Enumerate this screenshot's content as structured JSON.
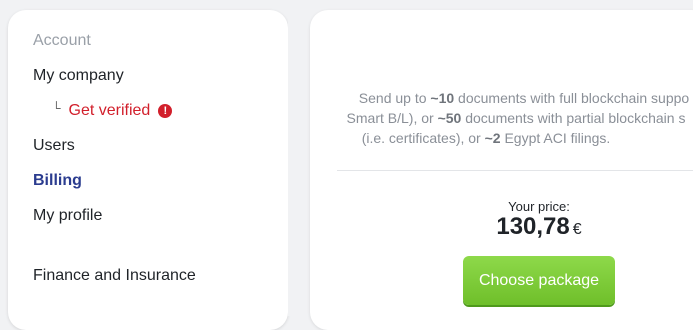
{
  "sidebar": {
    "section_title": "Account",
    "items": [
      {
        "label": "My company"
      },
      {
        "label": "Get verified"
      },
      {
        "label": "Users"
      },
      {
        "label": "Billing"
      },
      {
        "label": "My profile"
      },
      {
        "label": "Finance and Insurance"
      }
    ],
    "warning_icon_text": "!"
  },
  "package": {
    "description_line1_a": "Send up to ",
    "description_line1_b": "~10",
    "description_line1_c": " documents with full blockchain suppo",
    "description_line2_a": "Smart B/L), or ",
    "description_line2_b": "~50",
    "description_line2_c": " documents with partial blockchain s",
    "description_line3_a": "(i.e. certificates), or ",
    "description_line3_b": "~2",
    "description_line3_c": " Egypt ACI filings.",
    "price_label": "Your price:",
    "price_value": "130,78",
    "currency": "€",
    "choose_button": "Choose package"
  },
  "colors": {
    "accent": "#2b3c8f",
    "warning": "#d21f2b",
    "button": "#7cc83a"
  }
}
